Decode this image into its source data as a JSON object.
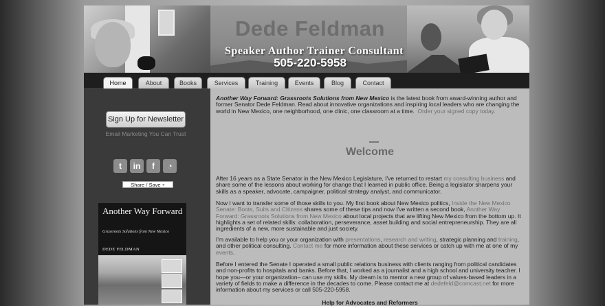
{
  "header": {
    "name": "Dede Feldman",
    "tagline": "Speaker  Author  Trainer  Consultant",
    "phone": "505-220-5958"
  },
  "nav": {
    "tabs": [
      {
        "label": "Home",
        "active": true
      },
      {
        "label": "About"
      },
      {
        "label": "Books"
      },
      {
        "label": "Services"
      },
      {
        "label": "Training"
      },
      {
        "label": "Events"
      },
      {
        "label": "Blog"
      },
      {
        "label": "Contact"
      }
    ]
  },
  "sidebar": {
    "newsletter_button": "Sign Up for Newsletter",
    "newsletter_sub": "Email Marketing You Can Trust",
    "social": [
      {
        "icon": "twitter-icon",
        "glyph": "t"
      },
      {
        "icon": "linkedin-icon",
        "glyph": "in"
      },
      {
        "icon": "facebook-icon",
        "glyph": "f"
      },
      {
        "icon": "rss-icon",
        "glyph": "◔"
      }
    ],
    "share_label": "Share / Save ÷",
    "book": {
      "title": "Another Way Forward",
      "subtitle": "Grassroots Solutions from New Mexico",
      "author": "DEDE FELDMAN"
    }
  },
  "content": {
    "intro_book": "Another Way Forward: Grassroots Solutions from New Mexico",
    "intro_text": " is the latest book from award-winning author and former Senator Dede Feldman. Read about innovative organizations and inspiring local leaders who are changing the world in New Mexico, one neighborhood, one clinic, one classroom at a time.",
    "intro_link": "Order your signed copy today.",
    "heading": "Welcome",
    "p1_a": "After 16 years as a State Senator in the New Mexico Legislature, I've returned to restart ",
    "p1_link": "my consulting business",
    "p1_b": " and share some of the lessons about working for change that I learned in public office. Being a legislator sharpens your skills as a speaker, advocate, campaigner, political strategy analyst, and communicator.",
    "p2_a": "Now I want to transfer some of those skills to you. My first book about New Mexico politics, ",
    "p2_link1": "Inside the New Mexico Senate: Boots, Suits and Citizens",
    "p2_b": " shares some of these tips and now I've written a second book, ",
    "p2_link2": "Another Way Forward: Grassroots Solutions from New Mexico",
    "p2_c": " about local projects that are lifting New Mexico from the bottom up.  It highlights a set of related skills: collaboration, perseverance, asset building and social entrepreneurship. They are all ingredients of a new, more sustainable and just society.",
    "p3_a": "I'm available to help you or your organization with ",
    "p3_link1": "presentations",
    "p3_sep1": ", ",
    "p3_link2": "research and writing",
    "p3_b": ", strategic planning and ",
    "p3_link3": "training",
    "p3_c": ", and other political consulting. ",
    "p3_link4": "Contact me",
    "p3_d": " for more information about these services or catch up with me at one of my ",
    "p3_link5": "events",
    "p3_e": ".",
    "p4_a": "Before I entered the Senate I operated a small public relations business with clients ranging from political candidates and non-profits to hospitals and banks. Before that, I worked as a journalist and a high school and university teacher. I hope you—or your organization– can use my skills. My dream is to mentor a new group of values-based leaders in a variety of fields to make a difference in the decades to come. Please contact me at ",
    "p4_link": "dedefeld@comcast.net",
    "p4_b": " for more information about my services or call 505-220-5958.",
    "help_heading": "Help for Advocates and Reformers"
  }
}
